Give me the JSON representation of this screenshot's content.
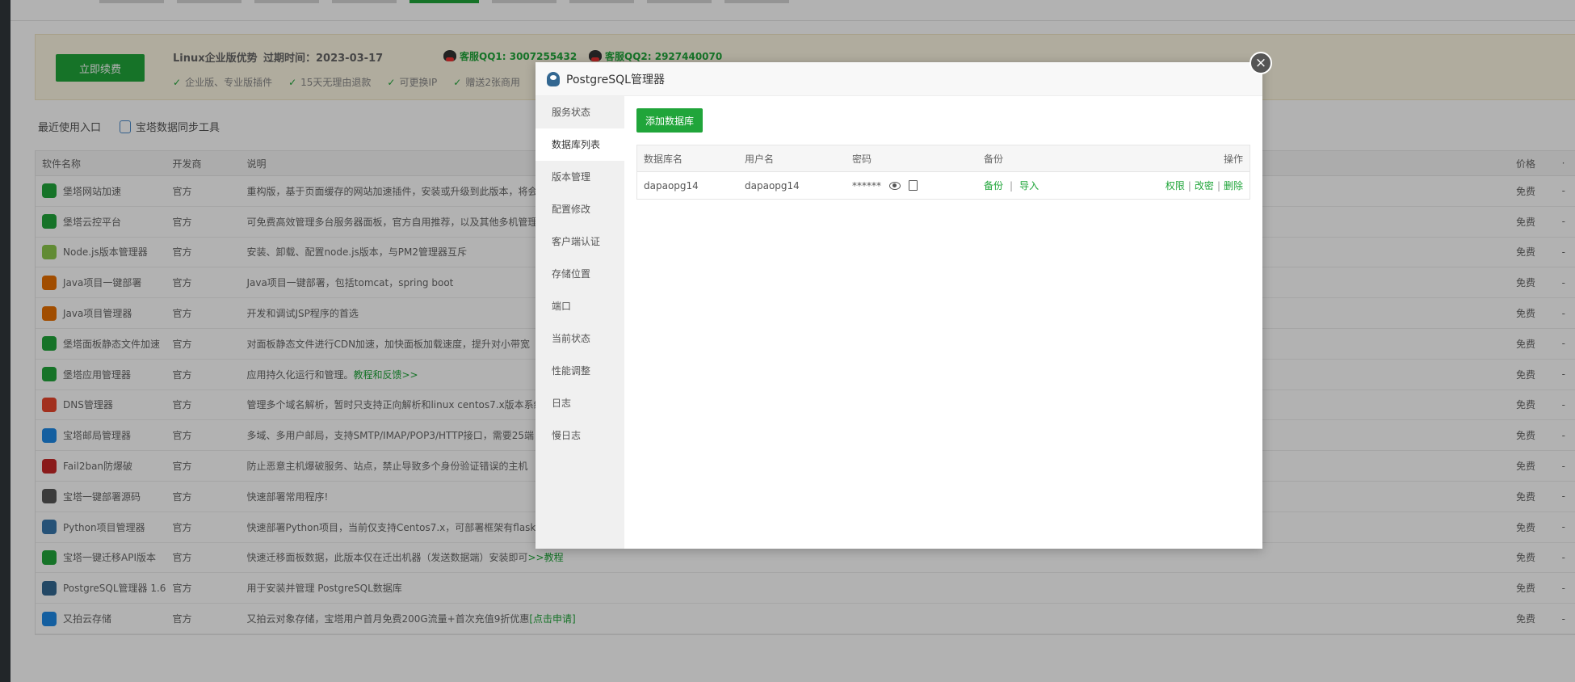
{
  "banner": {
    "renew_label": "立即续费",
    "title": "Linux企业版优势",
    "expire": "过期时间：2023-03-17",
    "qq1": "客服QQ1: 3007255432",
    "qq2": "客服QQ2: 2927440070",
    "features": [
      "企业版、专业版插件",
      "15天无理由退款",
      "可更换IP",
      "赠送2张商用"
    ]
  },
  "toolbar": {
    "recent_label": "最近使用入口",
    "sync_label": "宝塔数据同步工具"
  },
  "table": {
    "headers": [
      "软件名称",
      "开发商",
      "说明",
      "价格"
    ],
    "rows": [
      {
        "name": "堡塔网站加速",
        "dev": "官方",
        "desc": "重构版，基于页面缓存的网站加速插件，安装或升级到此版本，将会",
        "price": "免费",
        "icon": "bolt-icon",
        "color": "#20a53a"
      },
      {
        "name": "堡塔云控平台",
        "dev": "官方",
        "desc": "可免费高效管理多台服务器面板，官方自用推荐，以及其他多机管理",
        "price": "免费",
        "icon": "cloud-control-icon",
        "color": "#20a53a"
      },
      {
        "name": "Node.js版本管理器",
        "dev": "官方",
        "desc": "安装、卸载、配置node.js版本，与PM2管理器互斥",
        "price": "免费",
        "icon": "nodejs-icon",
        "color": "#8cc84b"
      },
      {
        "name": "Java项目一键部署",
        "dev": "官方",
        "desc": "Java项目一键部署，包括tomcat，spring boot",
        "price": "免费",
        "icon": "java-icon",
        "color": "#e76f00"
      },
      {
        "name": "Java项目管理器",
        "dev": "官方",
        "desc": "开发和调试JSP程序的首选",
        "price": "免费",
        "icon": "java-icon",
        "color": "#e76f00"
      },
      {
        "name": "堡塔面板静态文件加速",
        "dev": "官方",
        "desc": "对面板静态文件进行CDN加速，加快面板加载速度，提升对小带宽",
        "price": "免费",
        "icon": "file-bolt-icon",
        "color": "#20a53a"
      },
      {
        "name": "堡塔应用管理器",
        "dev": "官方",
        "desc": "应用持久化运行和管理。",
        "desc_link": "教程和反馈>>",
        "price": "免费",
        "icon": "app-manager-icon",
        "color": "#20a53a"
      },
      {
        "name": "DNS管理器",
        "dev": "官方",
        "desc": "管理多个域名解析，暂时只支持正向解析和linux centos7.x版本系统",
        "price": "免费",
        "icon": "dns-icon",
        "color": "#e8452c"
      },
      {
        "name": "宝塔邮局管理器",
        "dev": "官方",
        "desc": "多域、多用户邮局，支持SMTP/IMAP/POP3/HTTP接口，需要25端",
        "price": "免费",
        "icon": "mail-icon",
        "color": "#1e88e5"
      },
      {
        "name": "Fail2ban防爆破",
        "dev": "官方",
        "desc": "防止恶意主机爆破服务、站点，禁止导致多个身份验证错误的主机",
        "price": "免费",
        "icon": "shield-icon",
        "color": "#c62828"
      },
      {
        "name": "宝塔一键部署源码",
        "dev": "官方",
        "desc": "快速部署常用程序!",
        "price": "免费",
        "icon": "code-icon",
        "color": "#555555"
      },
      {
        "name": "Python项目管理器",
        "dev": "官方",
        "desc": "快速部署Python项目，当前仅支持Centos7.x，可部署框架有flask",
        "price": "免费",
        "icon": "python-icon",
        "color": "#3776ab"
      },
      {
        "name": "宝塔一键迁移API版本",
        "dev": "官方",
        "desc": "快速迁移面板数据，此版本仅在迁出机器（发送数据端）安装即可",
        "desc_link": ">>教程",
        "price": "免费",
        "icon": "check-circle-icon",
        "color": "#20a53a"
      },
      {
        "name": "PostgreSQL管理器 1.6",
        "dev": "官方",
        "desc": "用于安装并管理 PostgreSQL数据库",
        "price": "免费",
        "icon": "postgresql-icon",
        "color": "#336791"
      },
      {
        "name": "又拍云存储",
        "dev": "官方",
        "desc": "又拍云对象存储，宝塔用户首月免费200G流量+首次充值9折优惠",
        "desc_link": "[点击申请]",
        "price": "免费",
        "icon": "upyun-icon",
        "color": "#1e88e5"
      }
    ]
  },
  "modal": {
    "title": "PostgreSQL管理器",
    "close_icon": "×",
    "menu": [
      "服务状态",
      "数据库列表",
      "版本管理",
      "配置修改",
      "客户端认证",
      "存储位置",
      "端口",
      "当前状态",
      "性能调整",
      "日志",
      "慢日志"
    ],
    "active_menu": "数据库列表",
    "add_button": "添加数据库",
    "db_table": {
      "headers": {
        "name": "数据库名",
        "user": "用户名",
        "password": "密码",
        "backup": "备份",
        "ops": "操作"
      },
      "rows": [
        {
          "name": "dapaopg14",
          "user": "dapaopg14",
          "password": "******",
          "backup": "备份",
          "import": "导入",
          "perm": "权限",
          "chpwd": "改密",
          "delete": "删除"
        }
      ]
    }
  },
  "colors": {
    "accent": "#20a53a",
    "overlay": "rgba(0,0,0,0.3)"
  }
}
